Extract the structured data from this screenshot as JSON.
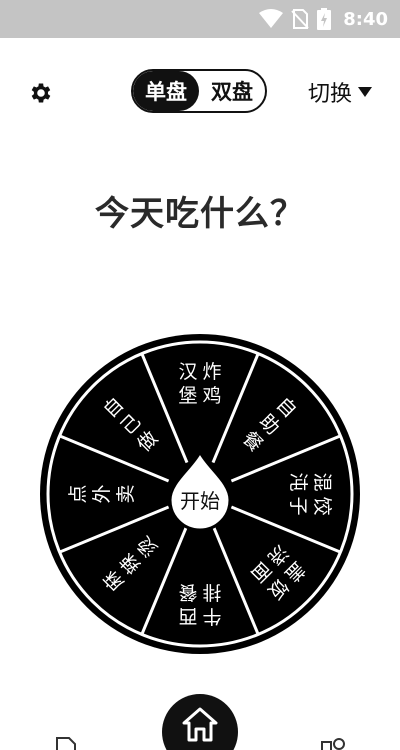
{
  "status_bar": {
    "time": "8:40"
  },
  "top_bar": {
    "mode_single": "单盘",
    "mode_double": "双盘",
    "switch_label": "切换"
  },
  "question": "今天吃什么？",
  "wheel": {
    "start_label": "开始",
    "segments": [
      {
        "label": "汉堡炸鸡"
      },
      {
        "label": "自助餐"
      },
      {
        "label": "混沌饺子"
      },
      {
        "label": "盖浇饭面"
      },
      {
        "label": "牛排西餐"
      },
      {
        "label": "麻辣烫"
      },
      {
        "label": "点外卖"
      },
      {
        "label": "自己做"
      }
    ]
  },
  "colors": {
    "wheel": "#000000",
    "status_bar": "#c4c4c4",
    "accent": "#111111"
  },
  "icons": {
    "settings": "gear-icon",
    "switch": "caret-down-icon",
    "home": "home-icon",
    "nav_left": "document-icon",
    "nav_right": "shapes-icon"
  }
}
